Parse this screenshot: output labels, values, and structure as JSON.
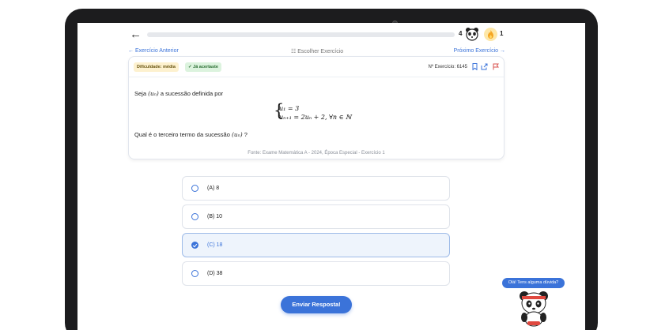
{
  "topbar": {
    "back_icon": "arrow-left-icon",
    "progress_fraction": 0,
    "streak_count": "4",
    "fire_count": "1"
  },
  "nav": {
    "prev_label": "← Exercício Anterior",
    "choose_label": "☷ Escolher Exercício",
    "next_label": "Próximo Exercício →"
  },
  "exercise": {
    "difficulty_badge": "Dificuldade: média",
    "solved_badge": "✓ Já acertaste",
    "number_label": "Nº Exercício: 6145",
    "intro_before": "Seja ",
    "intro_sequence": "(uₙ)",
    "intro_after": " a sucessão definida por",
    "system_line1": "u₁ = 3",
    "system_line2": "uₙ₊₁ = 2uₙ + 2,    ∀n ∈ ℕ",
    "question_before": "Qual é o terceiro termo da sucessão ",
    "question_sequence": "(uₙ)",
    "question_after": " ?",
    "source": "Fonte: Exame Matemática A - 2024, Época Especial - Exercício 1"
  },
  "options": [
    {
      "label": "(A) 8",
      "selected": false
    },
    {
      "label": "(B) 10",
      "selected": false
    },
    {
      "label": "(C) 18",
      "selected": true
    },
    {
      "label": "(D) 38",
      "selected": false
    }
  ],
  "submit_label": "Enviar Resposta!",
  "chat": {
    "bubble_text": "Olá! Tens alguma dúvida?"
  },
  "colors": {
    "accent": "#3b73d9",
    "selected_bg": "#eef4fc",
    "difficulty_bg": "#fdf1cf",
    "solved_bg": "#dcf3de",
    "flag": "#d9534f"
  }
}
